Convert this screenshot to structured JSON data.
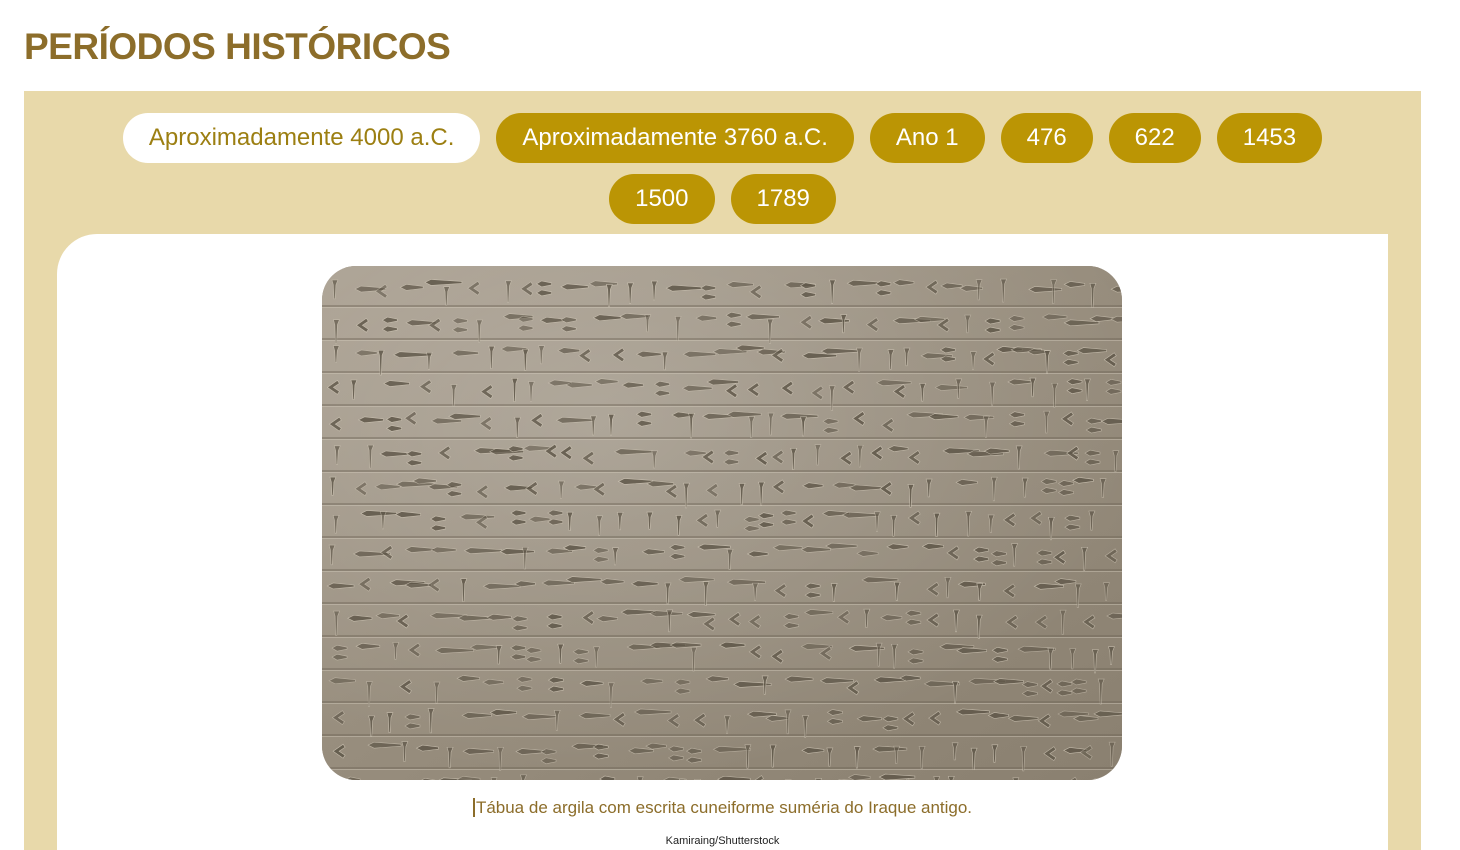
{
  "page": {
    "title": "PERÍODOS HISTÓRICOS"
  },
  "timeline": {
    "tabs": [
      {
        "label": "Aproximadamente 4000 a.C.",
        "active": true
      },
      {
        "label": "Aproximadamente 3760 a.C.",
        "active": false
      },
      {
        "label": "Ano 1",
        "active": false
      },
      {
        "label": "476",
        "active": false
      },
      {
        "label": "622",
        "active": false
      },
      {
        "label": "1453",
        "active": false
      },
      {
        "label": "1500",
        "active": false
      },
      {
        "label": "1789",
        "active": false
      }
    ]
  },
  "content": {
    "image_subject": "cuneiform-clay-tablet",
    "caption": "Tábua de argila com escrita cuneiforme suméria do Iraque antigo.",
    "credit": "Kamiraing/Shutterstock"
  },
  "colors": {
    "title": "#8c6d2a",
    "panel_background": "#e8d9aa",
    "tab_background": "#bb9504",
    "tab_active_background": "#ffffff",
    "tab_active_text": "#9c7f12"
  }
}
